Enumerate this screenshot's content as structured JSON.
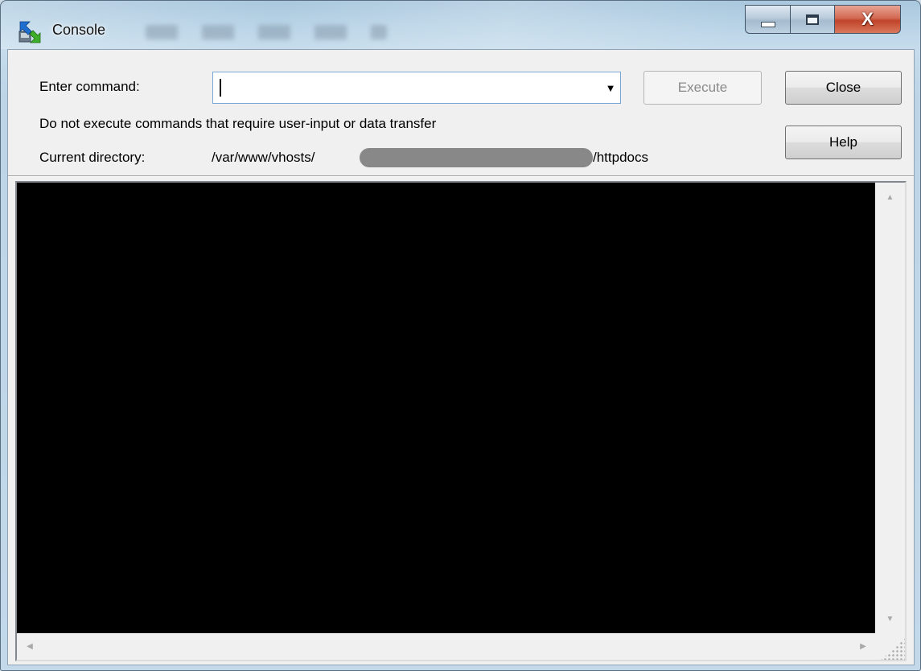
{
  "window": {
    "title": "Console",
    "icon": "console-app-icon"
  },
  "caption": {
    "minimize_icon": "minimize-icon",
    "maximize_icon": "maximize-icon",
    "close_glyph": "X"
  },
  "form": {
    "command_label": "Enter command:",
    "command_value": "",
    "warning": "Do not execute commands that require user-input or data transfer",
    "dir_label": "Current directory:",
    "dir_prefix": "/var/www/vhosts/",
    "dir_suffix": "/httpdocs"
  },
  "buttons": {
    "execute": "Execute",
    "close": "Close",
    "help": "Help"
  },
  "terminal": {
    "output": "",
    "background": "#000000"
  },
  "colors": {
    "close_button_red": "#c0442a",
    "focus_border": "#7aa7d7"
  }
}
